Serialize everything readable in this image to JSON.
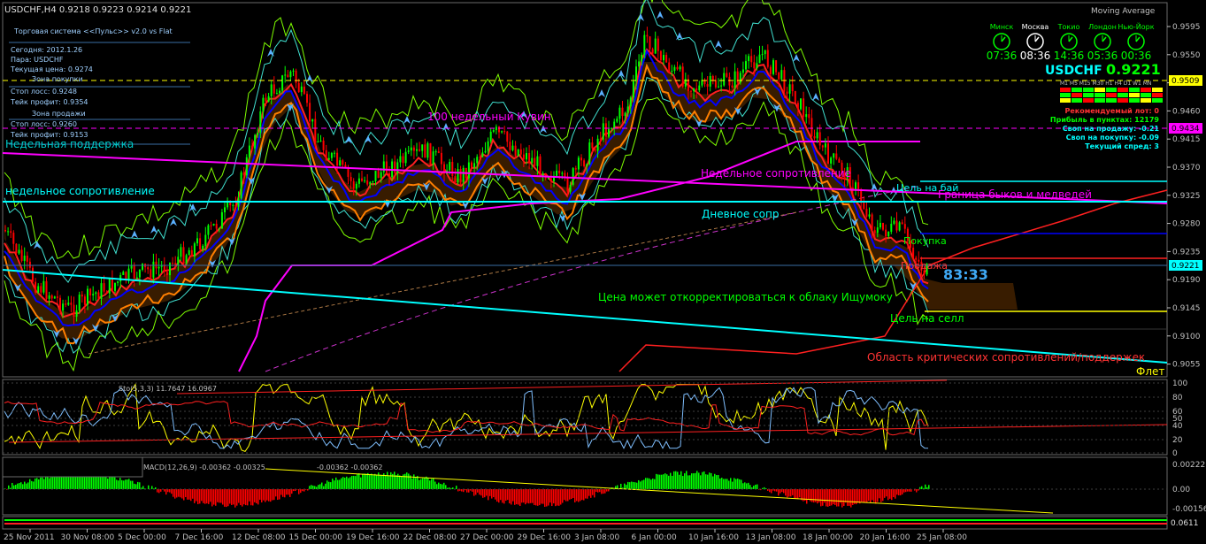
{
  "header": {
    "symbol_info": "USDCHF,H4  0.9218 0.9223 0.9214 0.9221",
    "indicator_name": "Moving Average"
  },
  "info_panel": {
    "title": "Торговая система <<Пульс>> v2.0 vs Flat",
    "today": "Сегодня:  2012.1.26",
    "pair": "Пара:   USDCHF",
    "current_price": "Текущая цена: 0.9274",
    "buy_zone": "Зона покупки",
    "buy_stop": "Стоп лосс:     0.9248",
    "buy_take": "Тейк профит:   0.9354",
    "sell_zone": "Зона продажи",
    "sell_stop": "Стоп лосс:     0.9260",
    "sell_take": "Тейк профит:   0.9153"
  },
  "clocks": [
    {
      "city": "Минск",
      "time": "07:36"
    },
    {
      "city": "Москва",
      "time": "08:36"
    },
    {
      "city": "Токио",
      "time": "14:36"
    },
    {
      "city": "Лондон",
      "time": "05:36"
    },
    {
      "city": "Нью-Йорк",
      "time": "00:36"
    }
  ],
  "price_box": {
    "symbol": "USDCHF",
    "price": "0.9221",
    "tf_labels": "M1 M5 M15 M30 H1 H4 D1 W1 MN"
  },
  "stats": {
    "lot": "Рекомендуемый лот: 0",
    "profit": "Прибыль в пунктах: 12179",
    "swap_sell": "Своп на продажу: -0.21",
    "swap_buy": "Своп на покупку: -0.09",
    "spread": "Текущий спред: 3"
  },
  "annotations": {
    "week100": "100 недельный Кувин",
    "weekly_support": "Недельная поддержка",
    "weekly_resistance_left": "недельное сопротивление",
    "weekly_resistance_mid": "Недельное сопротивление",
    "buy_target": "Цель на бай",
    "bull_bear": "Граница быков и медведей",
    "daily_res": "Дневное сопр",
    "buy": "Покупка",
    "sell": "Продажа",
    "timer": "83:33",
    "ichimoku": "Цена может откорректироваться к облаку Ищумоку",
    "sell_target": "Цель на селл",
    "critical": "Область критических сопротивлений/поддержек",
    "flat": "Флет"
  },
  "price_axis": {
    "ticks": [
      "0.9595",
      "0.9550",
      "0.9505",
      "0.9460",
      "0.9415",
      "0.9370",
      "0.9325",
      "0.9280",
      "0.9235",
      "0.9190",
      "0.9145",
      "0.9100",
      "0.9055"
    ],
    "badges": [
      {
        "value": "0.9509",
        "color": "#ffff00"
      },
      {
        "value": "0.9434",
        "color": "#ff00ff"
      },
      {
        "value": "0.9221",
        "color": "#00ffff"
      }
    ]
  },
  "stoch": {
    "label": "Sto(5,3,3) 11.7647 16.0967",
    "ticks": [
      "100",
      "80",
      "60",
      "50",
      "40",
      "20",
      "0"
    ]
  },
  "macd": {
    "label": "MACD(12,26,9) -0.00362 -0.00325",
    "label2": "-0.00362 -0.00362",
    "ticks": [
      "0.00222",
      "0.00",
      "-0.00156"
    ]
  },
  "bottom": {
    "tick": "0.0611"
  },
  "time_axis": [
    "25 Nov 2011",
    "30 Nov 08:00",
    "5 Dec 00:00",
    "7 Dec 16:00",
    "12 Dec 08:00",
    "15 Dec 00:00",
    "19 Dec 16:00",
    "22 Dec 08:00",
    "27 Dec 00:00",
    "29 Dec 16:00",
    "3 Jan 08:00",
    "6 Jan 00:00",
    "10 Jan 16:00",
    "13 Jan 08:00",
    "18 Jan 00:00",
    "20 Jan 16:00",
    "25 Jan 08:00"
  ],
  "colors": {
    "bg": "#000000",
    "axis": "#c0c0c0",
    "bull": "#00ff00",
    "bear": "#ff0000",
    "cyan": "#00ffff",
    "magenta": "#ff00ff",
    "orange": "#ff7f00",
    "yellow": "#ffff00",
    "blue": "#0000ff",
    "lime": "#7fff00"
  }
}
